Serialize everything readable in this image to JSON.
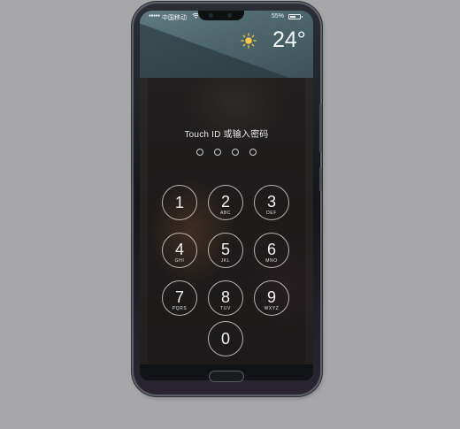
{
  "statusbar": {
    "carrier": "中国移动",
    "signal": "●●●●●",
    "battery": "55%",
    "battery_level": 0.55
  },
  "weather": {
    "icon": "sun-icon",
    "temperature": "24°"
  },
  "lock": {
    "prompt": "Touch ID 或输入密码",
    "passcode_length": 4,
    "entered": 0
  },
  "keypad": [
    {
      "digit": "1",
      "letters": ""
    },
    {
      "digit": "2",
      "letters": "ABC"
    },
    {
      "digit": "3",
      "letters": "DEF"
    },
    {
      "digit": "4",
      "letters": "GHI"
    },
    {
      "digit": "5",
      "letters": "JKL"
    },
    {
      "digit": "6",
      "letters": "MNO"
    },
    {
      "digit": "7",
      "letters": "PQRS"
    },
    {
      "digit": "8",
      "letters": "TUV"
    },
    {
      "digit": "9",
      "letters": "WXYZ"
    },
    {
      "digit": "0",
      "letters": ""
    }
  ],
  "colors": {
    "background": "#a7a7a9",
    "widget": "#5f7a80",
    "key_ring": "#ebe6e1"
  }
}
